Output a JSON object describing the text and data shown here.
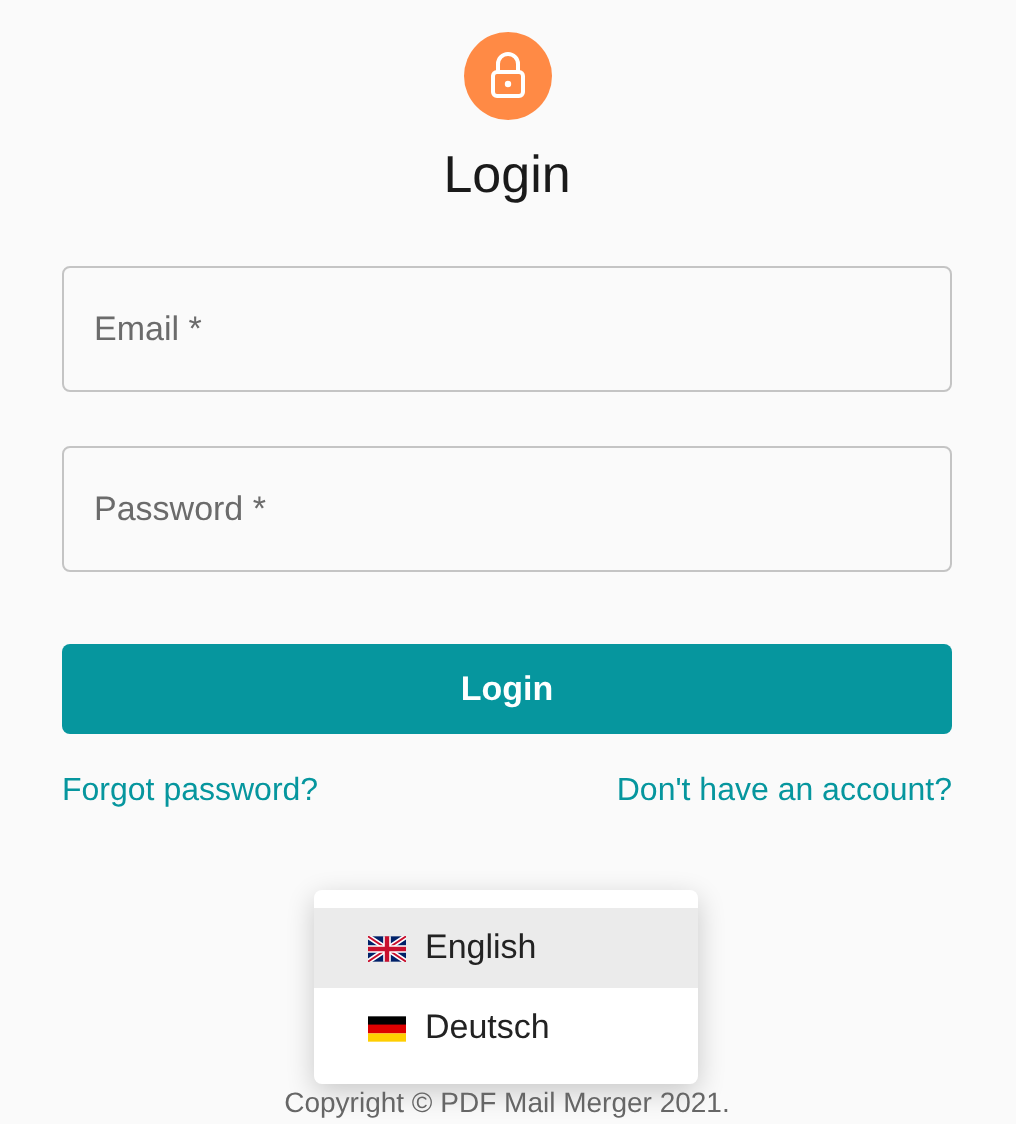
{
  "title": "Login",
  "fields": [
    {
      "placeholder": "Email *"
    },
    {
      "placeholder": "Password *"
    }
  ],
  "submit": "Login",
  "links": [
    "Forgot password?",
    "Don't have an account?"
  ],
  "language_menu": [
    {
      "label": "English",
      "kind": "uk",
      "selected": true
    },
    {
      "label": "Deutsch",
      "kind": "de",
      "selected": false
    }
  ],
  "footer": "Copyright © PDF Mail Merger 2021."
}
